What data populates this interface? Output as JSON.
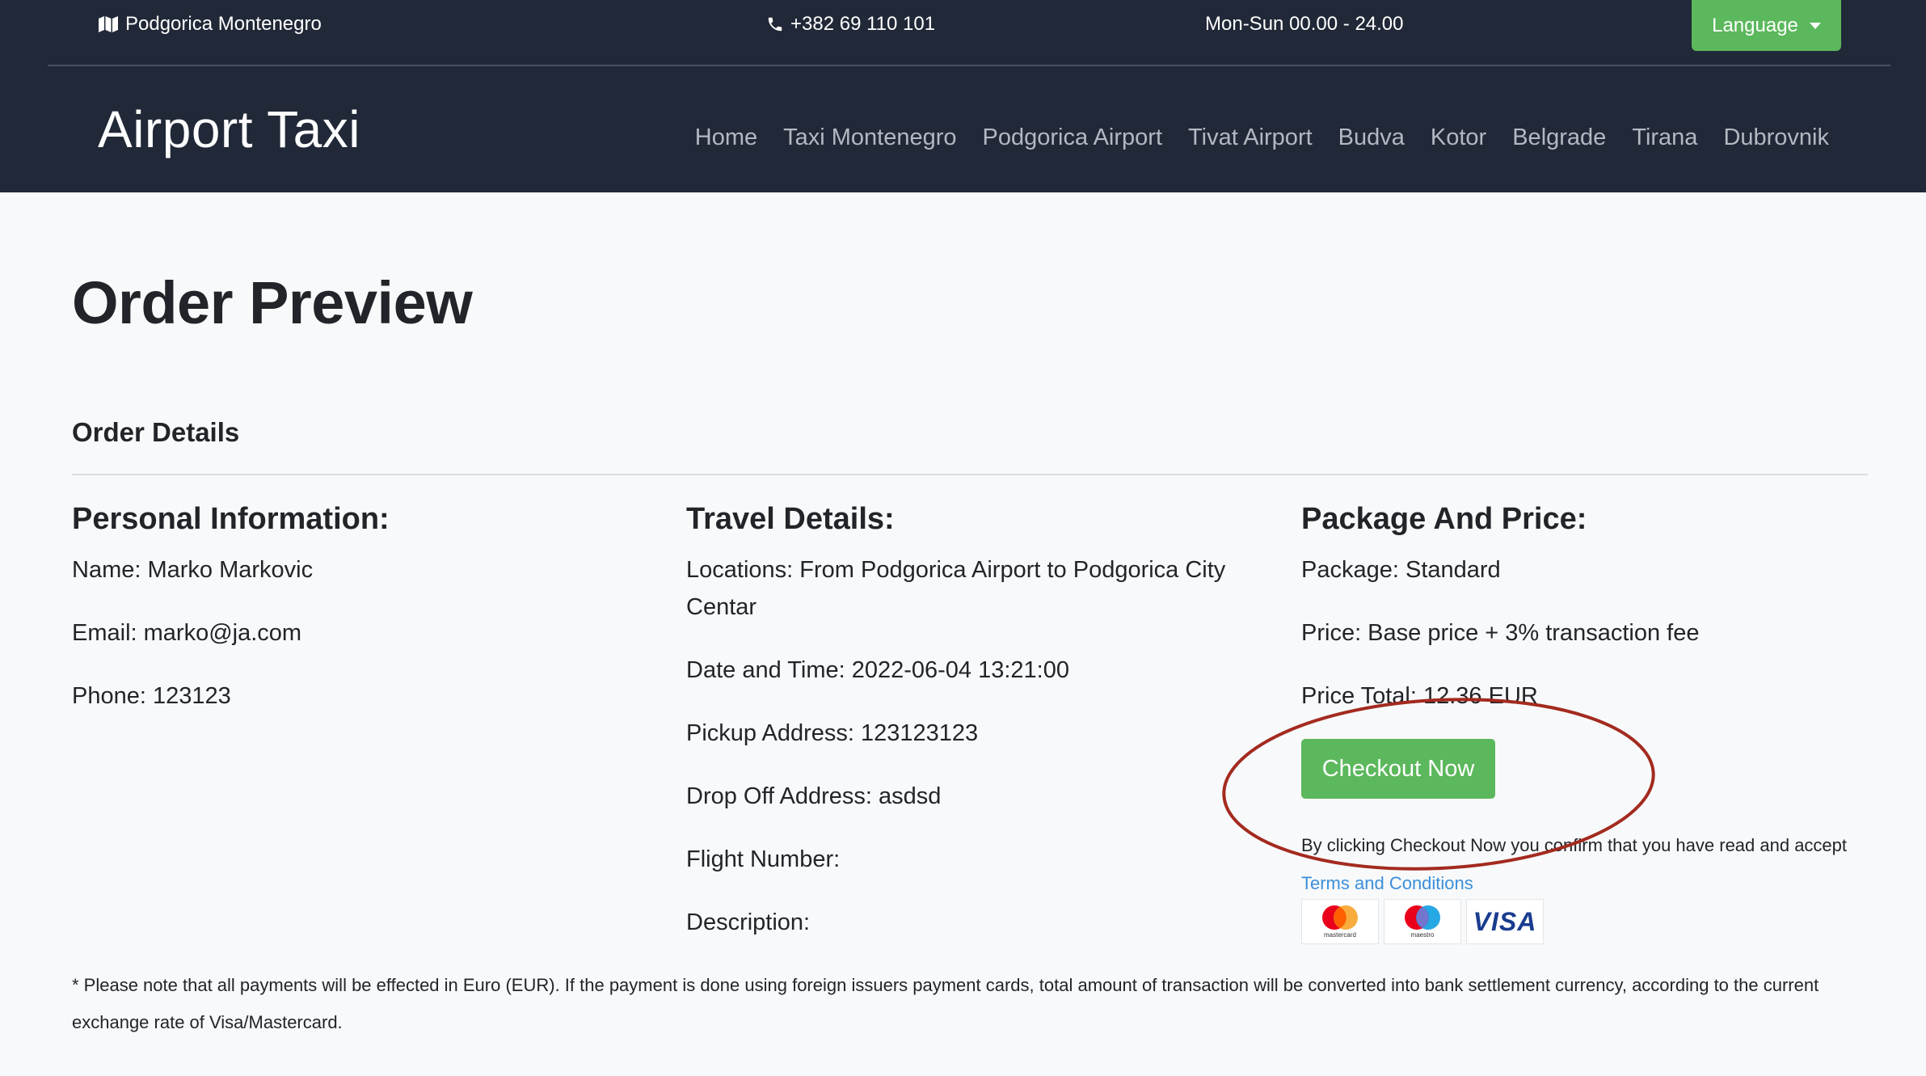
{
  "topbar": {
    "location": "Podgorica Montenegro",
    "phone": "+382 69 110 101",
    "hours": "Mon-Sun 00.00 - 24.00",
    "language_label": "Language"
  },
  "navbar": {
    "brand": "Airport Taxi",
    "links": [
      "Home",
      "Taxi Montenegro",
      "Podgorica Airport",
      "Tivat Airport",
      "Budva",
      "Kotor",
      "Belgrade",
      "Tirana",
      "Dubrovnik"
    ]
  },
  "page": {
    "title": "Order Preview",
    "section_title": "Order Details"
  },
  "personal": {
    "heading": "Personal Information:",
    "name": "Name: Marko Markovic",
    "email": "Email: marko@ja.com",
    "phone": "Phone: 123123"
  },
  "travel": {
    "heading": "Travel Details:",
    "locations": "Locations: From Podgorica Airport to Podgorica City Centar",
    "datetime": "Date and Time: 2022-06-04 13:21:00",
    "pickup": "Pickup Address: 123123123",
    "dropoff": "Drop Off Address: asdsd",
    "flight": "Flight Number:",
    "description": "Description:"
  },
  "package": {
    "heading": "Package And Price:",
    "package": "Package: Standard",
    "price": "Price: Base price + 3% transaction fee",
    "total": "Price Total: 12.36 EUR",
    "checkout_label": "Checkout Now",
    "consent_text": "By clicking Checkout Now you confirm that you have read and accept",
    "terms_link": "Terms and Conditions"
  },
  "payment_cards": {
    "mastercard_label": "mastercard",
    "maestro_label": "maestro",
    "visa_label": "VISA"
  },
  "note": "* Please note that all payments will be effected in Euro (EUR). If the payment is done using foreign issuers payment cards, total amount of transaction will be converted into bank settlement currency, according to the current exchange rate of Visa/Mastercard.",
  "icons": {
    "location": "map-icon",
    "phone": "phone-icon"
  },
  "colors": {
    "header_bg": "#212837",
    "accent_green": "#5cb85c",
    "link_blue": "#3b8fd9",
    "annotation_red": "#a32a1f"
  }
}
